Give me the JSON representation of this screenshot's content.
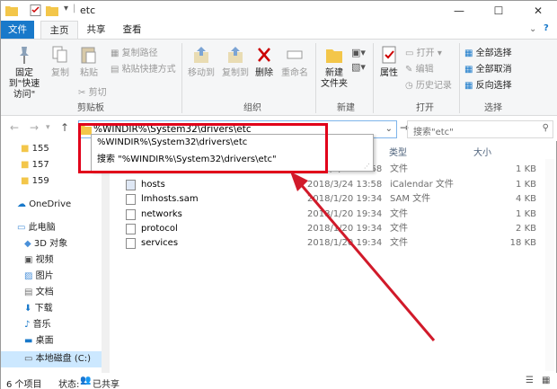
{
  "window": {
    "title": "etc"
  },
  "tabs": [
    "文件",
    "主页",
    "共享",
    "查看"
  ],
  "ribbon": {
    "clipboard": {
      "pin": "固定到\"快速访问\"",
      "copy": "复制",
      "paste": "粘贴",
      "copy_path": "复制路径",
      "paste_shortcut": "粘贴快捷方式",
      "cut": "剪切",
      "label": "剪贴板"
    },
    "organize": {
      "move_to": "移动到",
      "copy_to": "复制到",
      "delete": "删除",
      "rename": "重命名",
      "label": "组织"
    },
    "new": {
      "new_folder": "新建\n文件夹",
      "label": "新建"
    },
    "open": {
      "properties": "属性",
      "open": "打开",
      "edit": "编辑",
      "history": "历史记录",
      "label": "打开"
    },
    "select": {
      "select_all": "全部选择",
      "select_none": "全部取消",
      "invert": "反向选择",
      "label": "选择"
    }
  },
  "address": {
    "value": "%WINDIR%\\System32\\drivers\\etc",
    "search_placeholder": "搜索\"etc\""
  },
  "dropdown": {
    "item1": "%WINDIR%\\System32\\drivers\\etc",
    "item2": "搜索 \"%WINDIR%\\System32\\drivers\\etc\""
  },
  "sidebar": [
    {
      "label": "155"
    },
    {
      "label": "157"
    },
    {
      "label": "159"
    },
    {
      "label": "OneDrive"
    },
    {
      "label": "此电脑"
    },
    {
      "label": "3D 对象"
    },
    {
      "label": "视频"
    },
    {
      "label": "图片"
    },
    {
      "label": "文档"
    },
    {
      "label": "下载"
    },
    {
      "label": "音乐"
    },
    {
      "label": "桌面"
    },
    {
      "label": "本地磁盘 (C:)"
    }
  ],
  "columns": {
    "type": "类型",
    "size": "大小"
  },
  "files": [
    {
      "name": "",
      "date": "2018/3/24 13:58",
      "type": "文件",
      "size": "1 KB"
    },
    {
      "name": "hosts",
      "date": "2018/3/24 13:58",
      "type": "iCalendar 文件",
      "size": "1 KB"
    },
    {
      "name": "lmhosts.sam",
      "date": "2018/1/20 19:34",
      "type": "SAM 文件",
      "size": "4 KB"
    },
    {
      "name": "networks",
      "date": "2018/1/20 19:34",
      "type": "文件",
      "size": "1 KB"
    },
    {
      "name": "protocol",
      "date": "2018/1/20 19:34",
      "type": "文件",
      "size": "2 KB"
    },
    {
      "name": "services",
      "date": "2018/1/20 19:34",
      "type": "文件",
      "size": "18 KB"
    }
  ],
  "status": {
    "count": "6 个项目",
    "state_label": "状态:",
    "shared": "已共享"
  },
  "colors": {
    "accent": "#1979ca",
    "highlight": "#e1001a"
  }
}
